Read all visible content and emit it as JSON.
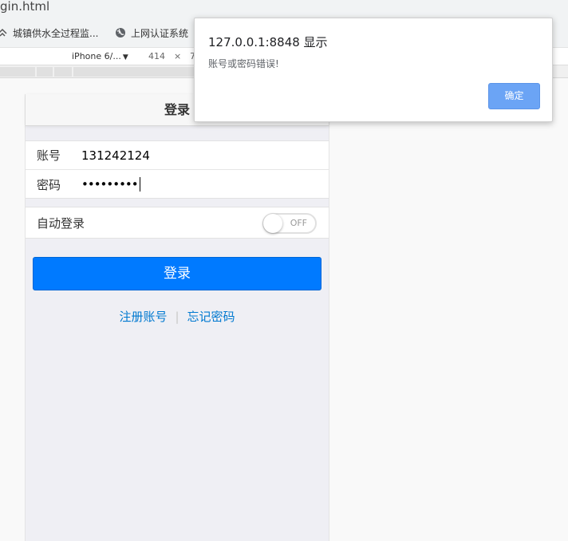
{
  "browser": {
    "url_fragment": "gin.html",
    "bookmarks": [
      {
        "label": "城镇供水全过程监...",
        "icon": "bookmark-site-icon"
      },
      {
        "label": "上网认证系统",
        "icon": "globe-icon"
      }
    ],
    "devtools": {
      "device": "iPhone 6/...",
      "width": "414",
      "times": "×",
      "height_partial": "7"
    }
  },
  "app": {
    "title": "登录",
    "account_label": "账号",
    "account_value": "131242124",
    "password_label": "密码",
    "password_mask": "•••••••••",
    "auto_login_label": "自动登录",
    "auto_login_state": "OFF",
    "auto_login_on": false,
    "login_button": "登录",
    "register_link": "注册账号",
    "separator": "|",
    "forgot_link": "忘记密码"
  },
  "dialog": {
    "origin": "127.0.0.1:8848 显示",
    "message": "账号或密码错误!",
    "ok_label": "确定"
  },
  "colors": {
    "primary": "#007aff",
    "link": "#0079d0",
    "dialog_button": "#6ba4f5"
  }
}
